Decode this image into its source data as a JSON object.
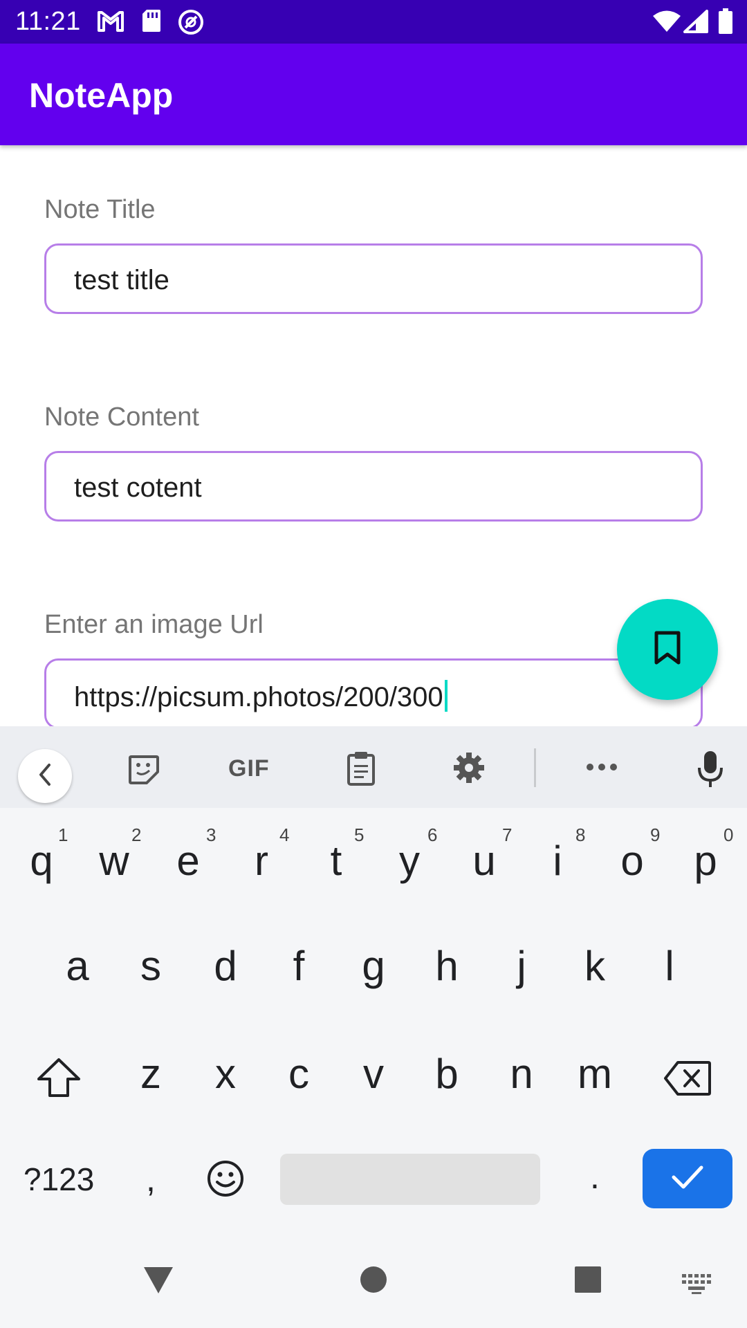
{
  "status_bar": {
    "time": "11:21",
    "icons_left": [
      "gmail-icon",
      "sd-card-icon",
      "do-not-disturb-icon"
    ],
    "icons_right": [
      "wifi-icon",
      "signal-icon",
      "battery-icon"
    ]
  },
  "app_bar": {
    "title": "NoteApp"
  },
  "form": {
    "title_field": {
      "label": "Note Title",
      "value": "test title"
    },
    "content_field": {
      "label": "Note Content",
      "value": "test cotent"
    },
    "url_field": {
      "label": "Enter an image Url",
      "value": "https://picsum.photos/200/300"
    }
  },
  "fab": {
    "icon": "bookmark-icon"
  },
  "keyboard": {
    "toolbar": [
      "back-chevron-icon",
      "sticker-icon",
      "gif-icon",
      "clipboard-icon",
      "settings-icon",
      "more-icon",
      "mic-icon"
    ],
    "gif_label": "GIF",
    "row1": [
      "q",
      "w",
      "e",
      "r",
      "t",
      "y",
      "u",
      "i",
      "o",
      "p"
    ],
    "row1_hints": [
      "1",
      "2",
      "3",
      "4",
      "5",
      "6",
      "7",
      "8",
      "9",
      "0"
    ],
    "row2": [
      "a",
      "s",
      "d",
      "f",
      "g",
      "h",
      "j",
      "k",
      "l"
    ],
    "row3": [
      "z",
      "x",
      "c",
      "v",
      "b",
      "n",
      "m"
    ],
    "symbols_label": "?123",
    "comma": ",",
    "period": "."
  },
  "colors": {
    "status_bar": "#3700b3",
    "app_bar": "#6200ee",
    "field_border": "#b77ee8",
    "fab": "#03dac5",
    "enter_key": "#1a73e8"
  }
}
